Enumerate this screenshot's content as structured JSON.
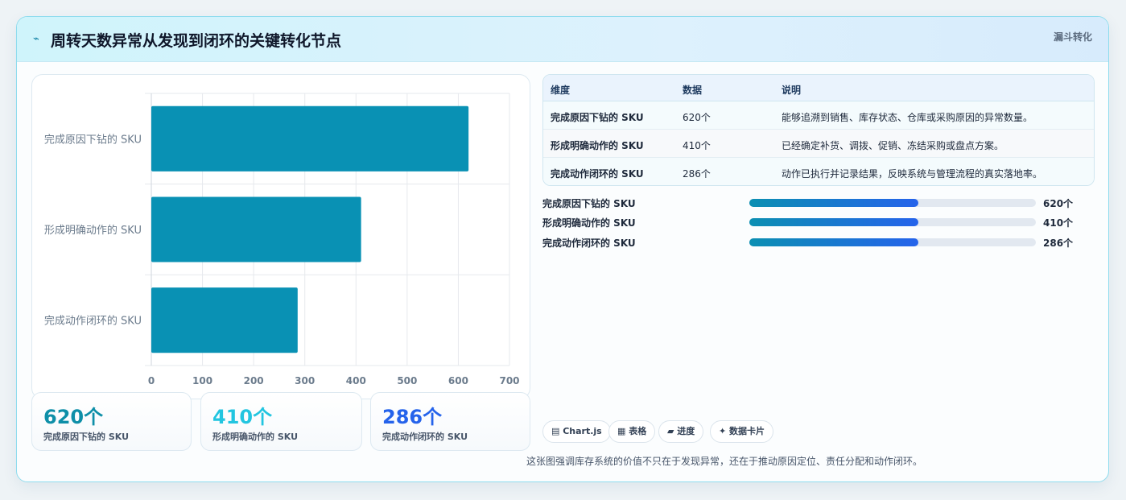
{
  "header": {
    "icon": "chart-line-icon",
    "title": "周转天数异常从发现到闭环的关键转化节点",
    "tag": "漏斗转化"
  },
  "chart_data": {
    "type": "bar",
    "orientation": "horizontal",
    "categories": [
      "完成原因下钻的 SKU",
      "形成明确动作的 SKU",
      "完成动作闭环的 SKU"
    ],
    "values": [
      620,
      410,
      286
    ],
    "xlim": [
      0,
      700
    ],
    "xticks": [
      0,
      100,
      200,
      300,
      400,
      500,
      600,
      700
    ],
    "grid": true,
    "bar_color": "#0991b4"
  },
  "stats": [
    {
      "value": "620个",
      "label": "完成原因下钻的 SKU",
      "color": "#0e8fa8"
    },
    {
      "value": "410个",
      "label": "形成明确动作的 SKU",
      "color": "#22c5e0"
    },
    {
      "value": "286个",
      "label": "完成动作闭环的 SKU",
      "color": "#2563eb"
    }
  ],
  "table": {
    "headers": [
      "维度",
      "数据",
      "说明"
    ],
    "rows": [
      [
        "完成原因下钻的 SKU",
        "620个",
        "能够追溯到销售、库存状态、仓库或采购原因的异常数量。"
      ],
      [
        "形成明确动作的 SKU",
        "410个",
        "已经确定补货、调拨、促销、冻结采购或盘点方案。"
      ],
      [
        "完成动作闭环的 SKU",
        "286个",
        "动作已执行并记录结果，反映系统与管理流程的真实落地率。"
      ]
    ]
  },
  "progress": [
    {
      "label": "完成原因下钻的 SKU",
      "value": "620个",
      "fraction": 0.59
    },
    {
      "label": "形成明确动作的 SKU",
      "value": "410个",
      "fraction": 0.59
    },
    {
      "label": "完成动作闭环的 SKU",
      "value": "286个",
      "fraction": 0.59
    }
  ],
  "chips": [
    {
      "label": "▤ Chart.js",
      "icon": "chart-icon"
    },
    {
      "label": "▦ 表格",
      "icon": "table-icon"
    },
    {
      "label": "▰ 进度",
      "icon": "progress-icon"
    },
    {
      "label": "✦ 数据卡片",
      "icon": "sparkle-icon"
    }
  ],
  "footnote": "这张图强调库存系统的价值不只在于发现异常，还在于推动原因定位、责任分配和动作闭环。"
}
